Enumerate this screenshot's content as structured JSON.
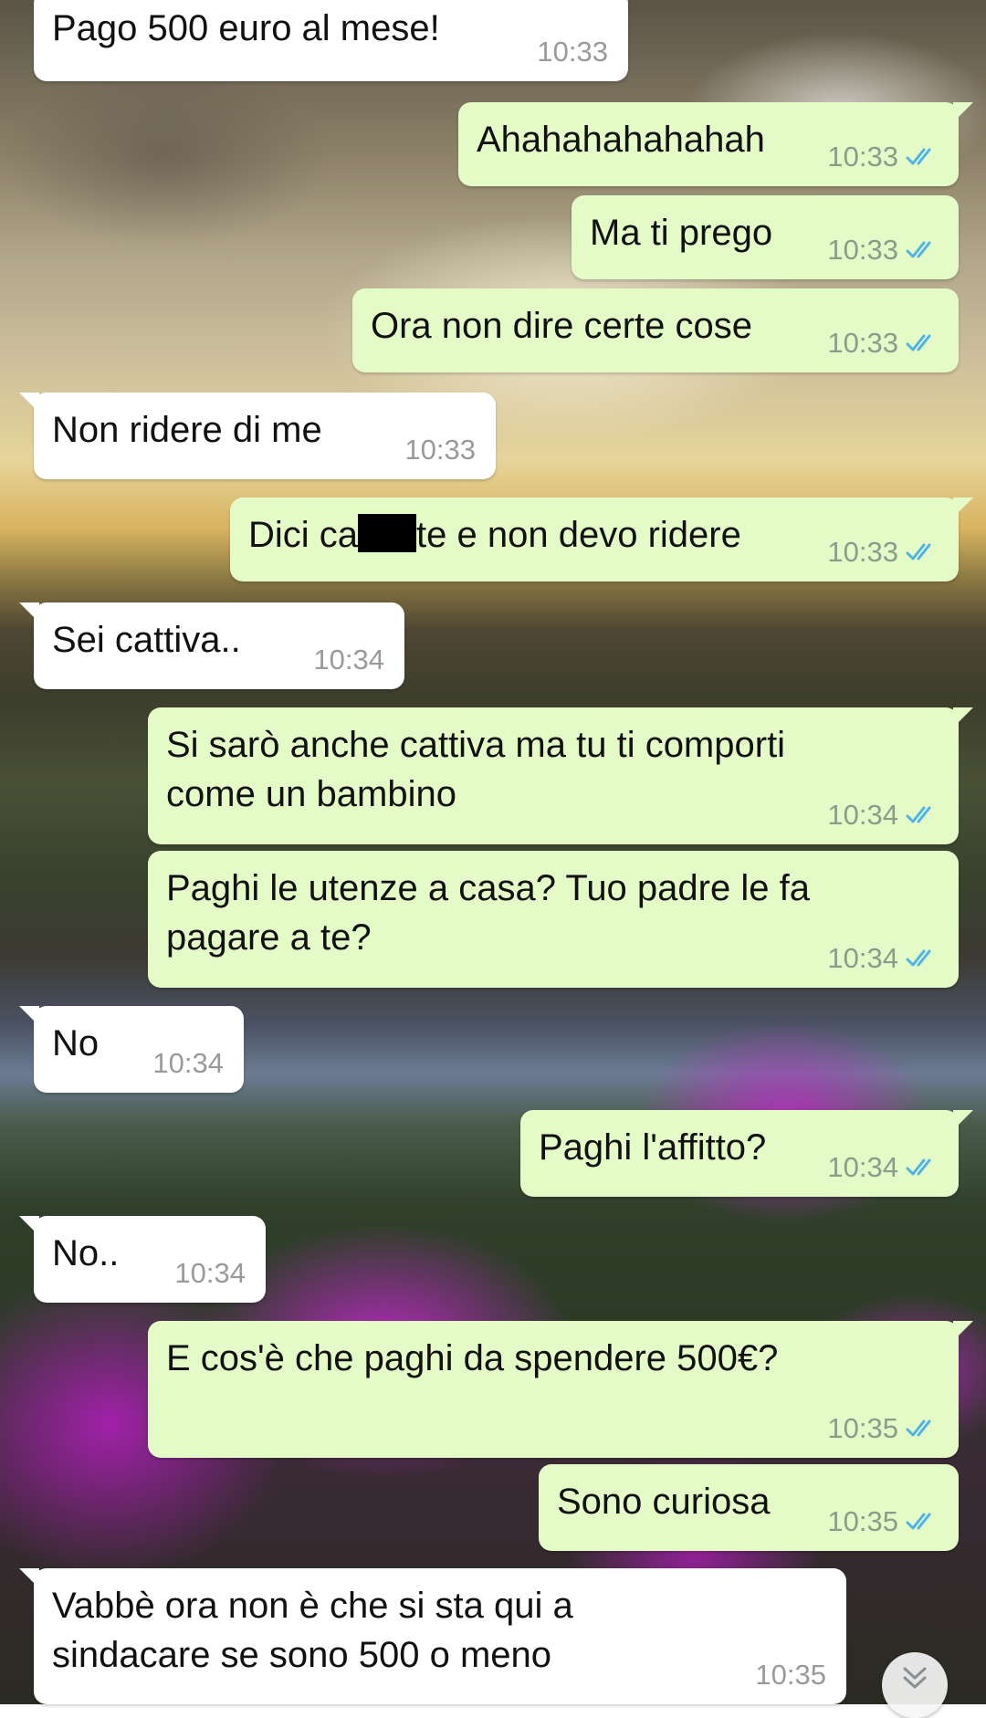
{
  "messages": [
    {
      "dir": "in",
      "text": "Pago 500 euro al mese!",
      "time": "10:33"
    },
    {
      "dir": "out",
      "text": "Ahahahahahahah",
      "time": "10:33",
      "status": "read"
    },
    {
      "dir": "out",
      "text": "Ma ti prego",
      "time": "10:33",
      "status": "read"
    },
    {
      "dir": "out",
      "text": "Ora non dire certe cose",
      "time": "10:33",
      "status": "read"
    },
    {
      "dir": "in",
      "text": "Non ridere di me",
      "time": "10:33"
    },
    {
      "dir": "out",
      "text_before": "Dici ca",
      "text_after": "te e non devo ridere",
      "time": "10:33",
      "status": "read"
    },
    {
      "dir": "in",
      "text": "Sei cattiva..",
      "time": "10:34"
    },
    {
      "dir": "out",
      "text": "Si sarò anche cattiva ma tu ti comporti\ncome un bambino",
      "time": "10:34",
      "status": "read"
    },
    {
      "dir": "out",
      "text": "Paghi le utenze a casa? Tuo padre le fa\npagare a te?",
      "time": "10:34",
      "status": "read"
    },
    {
      "dir": "in",
      "text": "No",
      "time": "10:34"
    },
    {
      "dir": "out",
      "text": "Paghi l'affitto?",
      "time": "10:34",
      "status": "read"
    },
    {
      "dir": "in",
      "text": "No..",
      "time": "10:34"
    },
    {
      "dir": "out",
      "text": "E cos'è che paghi da spendere 500€?",
      "time": "10:35",
      "status": "read"
    },
    {
      "dir": "out",
      "text": "Sono curiosa",
      "time": "10:35",
      "status": "read"
    },
    {
      "dir": "in",
      "text": "Vabbè ora non è che si sta qui a\nsindacare se sono 500 o meno",
      "time": "10:35"
    }
  ],
  "colors": {
    "incoming_bubble": "#ffffff",
    "outgoing_bubble": "#e4fbc8",
    "read_ticks": "#4fb3e8",
    "timestamp": "#8e9a8a"
  },
  "icons": {
    "read_receipt": "double-check-icon",
    "scroll_down": "chevron-double-down-icon"
  }
}
